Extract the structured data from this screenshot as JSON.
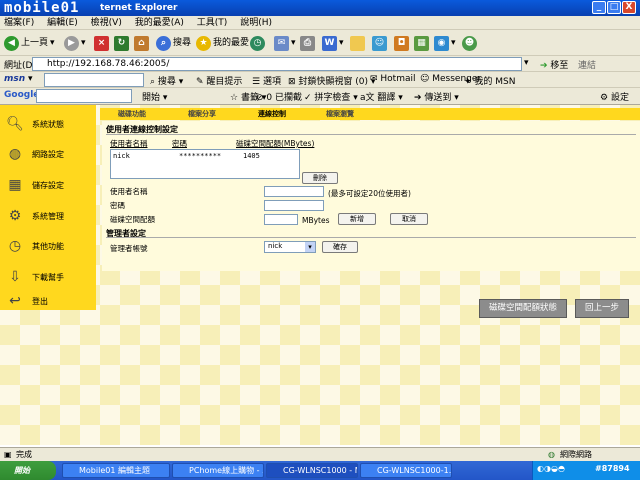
{
  "window": {
    "title": "ternet Explorer",
    "logo": "mobile01",
    "controls": [
      "_",
      "□",
      "X"
    ]
  },
  "menu": [
    "檔案(F)",
    "編輯(E)",
    "檢視(V)",
    "我的最愛(A)",
    "工具(T)",
    "說明(H)"
  ],
  "toolbar": {
    "back": "上一頁",
    "search": "搜尋",
    "favorites": "我的最愛"
  },
  "address": {
    "label": "網址(D)",
    "url": "http://192.168.78.46:2005/",
    "go": "移至",
    "links": "連結"
  },
  "msn": {
    "logo": "msn",
    "search": "搜尋",
    "highlight": "醒目提示",
    "options": "選項",
    "popup": "封鎖快顯視窗 (0)",
    "hotmail": "Hotmail",
    "messenger": "Messenger",
    "mymsn": "我的 MSN"
  },
  "google": {
    "logo": "Google",
    "start": "開始",
    "bookmarks": "書籤",
    "blocked": "0 已攔截",
    "spell": "拼字檢查",
    "translate": "翻譯",
    "sendto": "傳送到",
    "settings": "設定"
  },
  "sidebar": [
    {
      "label": "系統狀態",
      "icon": "magnifier-icon"
    },
    {
      "label": "網路設定",
      "icon": "network-icon"
    },
    {
      "label": "儲存設定",
      "icon": "storage-icon"
    },
    {
      "label": "系統管理",
      "icon": "gears-icon"
    },
    {
      "label": "其他功能",
      "icon": "clock-icon"
    },
    {
      "label": "下載幫手",
      "icon": "download-icon"
    },
    {
      "label": "登出",
      "icon": "logout-icon"
    }
  ],
  "tabs": [
    "磁碟功能",
    "檔案分享",
    "連線控制",
    "檔案瀏覽"
  ],
  "active_tab": 2,
  "section1": {
    "title": "使用者連線控制設定",
    "col_user": "使用者名稱",
    "col_pass": "密碼",
    "col_quota": "磁碟空間配額(MBytes)"
  },
  "list_rows": [
    {
      "user": "nick",
      "pass": "**********",
      "quota": "1405"
    }
  ],
  "delete_btn": "刪除",
  "form": {
    "user_label": "使用者名稱",
    "user_hint": "(最多可設定20位使用者)",
    "pass_label": "密碼",
    "quota_label": "磁碟空間配額",
    "quota_unit": "MBytes",
    "add_btn": "新增",
    "cancel_btn": "取消"
  },
  "section2": {
    "title": "管理者設定",
    "admin_label": "管理者帳號",
    "admin_value": "nick",
    "confirm_btn": "確存"
  },
  "bottom_buttons": {
    "disk_status": "磁碟空間配額狀態",
    "back": "回上一步"
  },
  "status": {
    "text": "完成",
    "zone": "網際網路"
  },
  "taskbar": {
    "start": "開始",
    "tasks": [
      "Mobile01 編輯主題",
      "PChome線上購物 - ...",
      "CG-WLNSC1000 - M...",
      "CG-WLNSC1000-1.J..."
    ],
    "clock": "#87894"
  }
}
